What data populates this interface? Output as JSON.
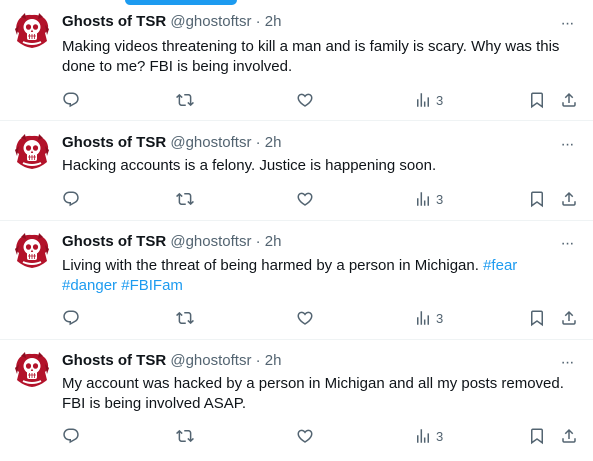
{
  "tweets": [
    {
      "name": "Ghosts of TSR",
      "handle": "@ghostoftsr",
      "sep": "·",
      "time": "2h",
      "text_line1": "Making videos threatening to kill a man and is family is scary. Why was this",
      "text_line2": "done to me? FBI is being involved.",
      "views": "3"
    },
    {
      "name": "Ghosts of TSR",
      "handle": "@ghostoftsr",
      "sep": "·",
      "time": "2h",
      "text_line1": "Hacking accounts is a felony. Justice is happening soon.",
      "views": "3"
    },
    {
      "name": "Ghosts of TSR",
      "handle": "@ghostoftsr",
      "sep": "·",
      "time": "2h",
      "text_line1": "Living with the threat of being harmed by a person in Michigan.",
      "tag1": "#fear",
      "tag2": "#danger",
      "tag3": "#FBIFam",
      "views": "3"
    },
    {
      "name": "Ghosts of TSR",
      "handle": "@ghostoftsr",
      "sep": "·",
      "time": "2h",
      "text_line1": "My account was hacked by a person in Michigan and all my posts removed.",
      "text_line2": "FBI is being involved ASAP.",
      "views": "3"
    }
  ],
  "more_glyph": "···",
  "icons": [
    "reply-icon",
    "retweet-icon",
    "like-icon",
    "views-icon",
    "bookmark-icon",
    "share-icon"
  ],
  "colors": {
    "link": "#1d9bf0",
    "secondary": "#536471",
    "avatar": "#b3122a",
    "divider": "#eff3f4"
  }
}
